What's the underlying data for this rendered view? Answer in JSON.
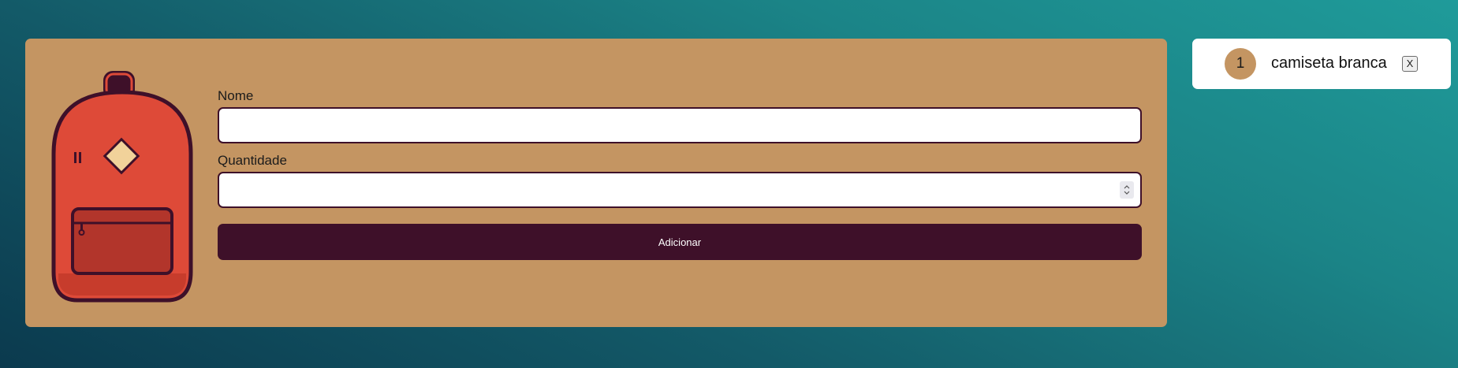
{
  "form": {
    "name_label": "Nome",
    "name_value": "",
    "quantity_label": "Quantidade",
    "quantity_value": "",
    "submit_label": "Adicionar"
  },
  "icons": {
    "hero": "backpack-icon",
    "spinner_up": "chevron-up-icon",
    "spinner_down": "chevron-down-icon"
  },
  "list": {
    "items": [
      {
        "quantity": "1",
        "name": "camiseta branca",
        "remove_label": "X"
      }
    ]
  },
  "colors": {
    "card_background": "#c49562",
    "accent_dark": "#3e1029",
    "backpack_red": "#de4a38",
    "badge": "#c49562"
  }
}
